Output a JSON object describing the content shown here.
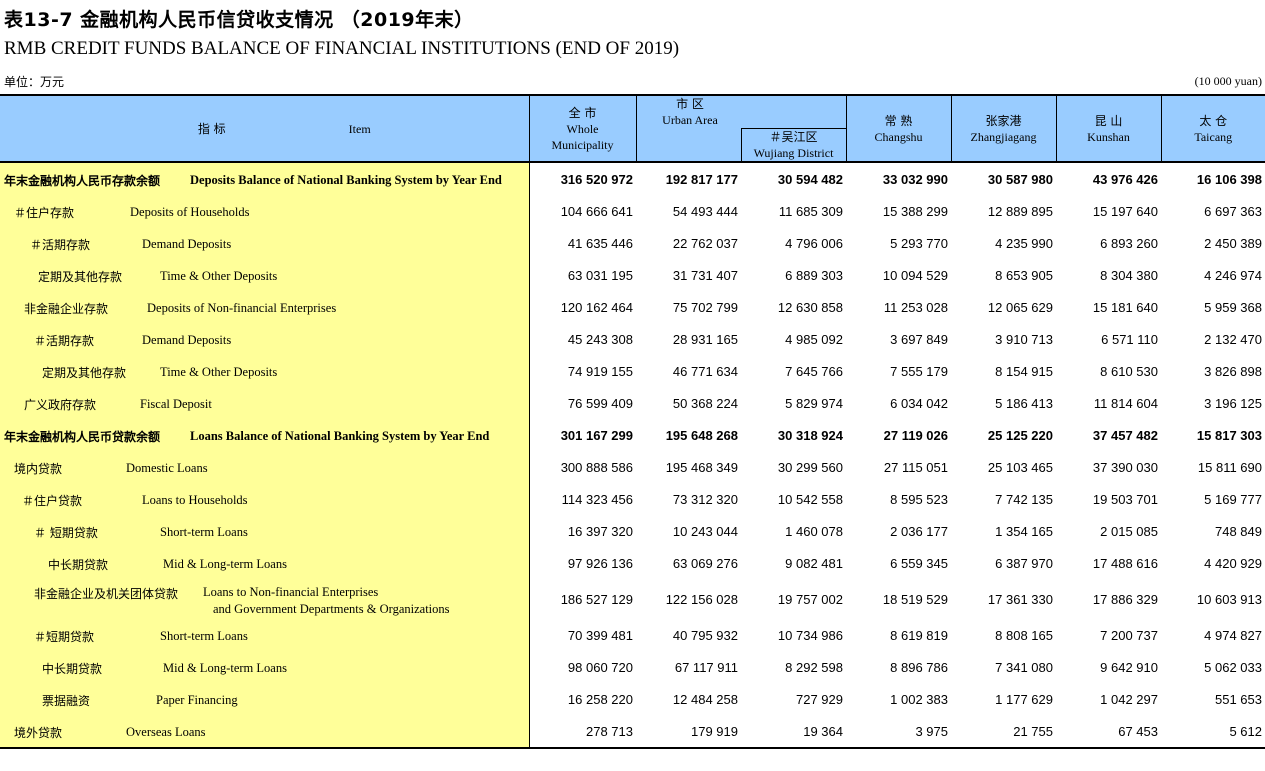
{
  "title_cn": "表13-7  金融机构人民币信贷收支情况 （2019年末）",
  "title_en": "RMB CREDIT FUNDS BALANCE OF FINANCIAL INSTITUTIONS (END OF 2019)",
  "unit_cn": "单位：万元",
  "unit_en": "(10 000 yuan)",
  "header": {
    "item_cn": "指    标",
    "item_en": "Item",
    "whole_cn": "全 市",
    "whole_en1": "Whole",
    "whole_en2": "Municipality",
    "urban_cn": "市 区",
    "urban_en": "Urban Area",
    "wujiang_cn": "＃吴江区",
    "wujiang_en": "Wujiang District",
    "changshu_cn": "常 熟",
    "changshu_en": "Changshu",
    "zhangjiagang_cn": "张家港",
    "zhangjiagang_en": "Zhangjiagang",
    "kunshan_cn": "昆 山",
    "kunshan_en": "Kunshan",
    "taicang_cn": "太 仓",
    "taicang_en": "Taicang"
  },
  "rows": [
    {
      "cn": "年末金融机构人民币存款余额",
      "en": "Deposits Balance of National Banking System by Year End",
      "v": [
        "316 520 972",
        "192 817 177",
        "30 594 482",
        "33 032 990",
        "30 587 980",
        "43 976 426",
        "16 106 398"
      ]
    },
    {
      "cn": "＃住户存款",
      "en": "Deposits of Households",
      "v": [
        "104 666 641",
        "54 493 444",
        "11 685 309",
        "15 388 299",
        "12 889 895",
        "15 197 640",
        "6 697 363"
      ]
    },
    {
      "cn": "＃活期存款",
      "en": "Demand Deposits",
      "v": [
        "41 635 446",
        "22 762 037",
        "4 796 006",
        "5 293 770",
        "4 235 990",
        "6 893 260",
        "2 450 389"
      ]
    },
    {
      "cn": "定期及其他存款",
      "en": "Time & Other Deposits",
      "v": [
        "63 031 195",
        "31 731 407",
        "6 889 303",
        "10 094 529",
        "8 653 905",
        "8 304 380",
        "4 246 974"
      ]
    },
    {
      "cn": "非金融企业存款",
      "en": "Deposits of Non-financial Enterprises",
      "v": [
        "120 162 464",
        "75 702 799",
        "12 630 858",
        "11 253 028",
        "12 065 629",
        "15 181 640",
        "5 959 368"
      ]
    },
    {
      "cn": "＃活期存款",
      "en": "Demand Deposits",
      "v": [
        "45 243 308",
        "28 931 165",
        "4 985 092",
        "3 697 849",
        "3 910 713",
        "6 571 110",
        "2 132 470"
      ]
    },
    {
      "cn": "定期及其他存款",
      "en": "Time & Other Deposits",
      "v": [
        "74 919 155",
        "46 771 634",
        "7 645 766",
        "7 555 179",
        "8 154 915",
        "8 610 530",
        "3 826 898"
      ]
    },
    {
      "cn": "广义政府存款",
      "en": "Fiscal Deposit",
      "v": [
        "76 599 409",
        "50 368 224",
        "5 829 974",
        "6 034 042",
        "5 186 413",
        "11 814 604",
        "3 196 125"
      ]
    },
    {
      "cn": "年末金融机构人民币贷款余额",
      "en": "Loans Balance of National Banking System by Year End",
      "v": [
        "301 167 299",
        "195 648 268",
        "30 318 924",
        "27 119 026",
        "25 125 220",
        "37 457 482",
        "15 817 303"
      ]
    },
    {
      "cn": "境内贷款",
      "en": "Domestic Loans",
      "v": [
        "300 888 586",
        "195 468 349",
        "30 299 560",
        "27 115 051",
        "25 103 465",
        "37 390 030",
        "15 811 690"
      ]
    },
    {
      "cn": "＃住户贷款",
      "en": "Loans to Households",
      "v": [
        "114 323 456",
        "73 312 320",
        "10 542 558",
        "8 595 523",
        "7 742 135",
        "19 503 701",
        "5 169 777"
      ]
    },
    {
      "cn": "＃  短期贷款",
      "en": "Short-term Loans",
      "v": [
        "16 397 320",
        "10 243 044",
        "1 460 078",
        "2 036 177",
        "1 354 165",
        "2 015 085",
        "748 849"
      ]
    },
    {
      "cn": "中长期贷款",
      "en": "Mid & Long-term Loans",
      "v": [
        "97 926 136",
        "63 069 276",
        "9 082 481",
        "6 559 345",
        "6 387 970",
        "17 488 616",
        "4 420 929"
      ]
    },
    {
      "cn": "非金融企业及机关团体贷款",
      "en": "Loans to Non-financial Enterprises",
      "en2": "and Government Departments & Organizations",
      "v": [
        "186 527 129",
        "122 156 028",
        "19 757 002",
        "18 519 529",
        "17 361 330",
        "17 886 329",
        "10 603 913"
      ]
    },
    {
      "cn": "＃短期贷款",
      "en": "Short-term Loans",
      "v": [
        "70 399 481",
        "40 795 932",
        "10 734 986",
        "8 619 819",
        "8 808 165",
        "7 200 737",
        "4 974 827"
      ]
    },
    {
      "cn": "中长期贷款",
      "en": "Mid & Long-term Loans",
      "v": [
        "98 060 720",
        "67 117 911",
        "8 292 598",
        "8 896 786",
        "7 341 080",
        "9 642 910",
        "5 062 033"
      ]
    },
    {
      "cn": "票据融资",
      "en": "Paper Financing",
      "v": [
        "16 258 220",
        "12 484 258",
        "727 929",
        "1 002 383",
        "1 177 629",
        "1 042 297",
        "551 653"
      ]
    },
    {
      "cn": "境外贷款",
      "en": "Overseas Loans",
      "v": [
        "278 713",
        "179 919",
        "19 364",
        "3 975",
        "21 755",
        "67 453",
        "5 612"
      ]
    }
  ]
}
